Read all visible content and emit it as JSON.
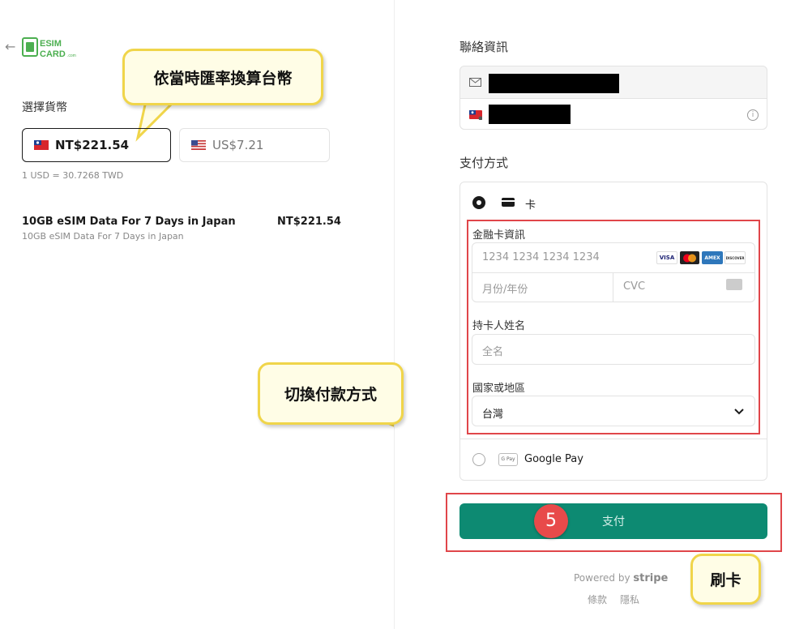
{
  "left": {
    "logo_line1": "ESIM",
    "logo_line2": "CARD",
    "logo_line3": ".com",
    "section_label": "選擇貨幣",
    "currency_selected": "NT$221.54",
    "currency_other": "US$7.21",
    "rate_note": "1 USD = 30.7268 TWD",
    "item_name": "10GB eSIM Data For 7 Days in Japan",
    "item_desc": "10GB eSIM Data For 7 Days in Japan",
    "item_price": "NT$221.54"
  },
  "right": {
    "contact_heading": "聯絡資訊",
    "pay_heading": "支付方式",
    "card_label": "卡",
    "card_info_label": "金融卡資訊",
    "card_number_placeholder": "1234 1234 1234 1234",
    "expiry_placeholder": "月份/年份",
    "cvc_placeholder": "CVC",
    "brands": {
      "visa": "VISA",
      "amex": "AMEX",
      "discover": "DISCOVER"
    },
    "holder_label": "持卡人姓名",
    "holder_placeholder": "全名",
    "country_label": "國家或地區",
    "country_value": "台灣",
    "gpay_icon": "G Pay",
    "gpay_label": "Google Pay",
    "pay_button": "支付",
    "powered_prefix": "Powered by",
    "powered_brand": "stripe",
    "terms_link": "條款",
    "privacy_link": "隱私"
  },
  "annotations": {
    "bubble_rate": "依當時匯率換算台幣",
    "bubble_switch": "切換付款方式",
    "bubble_pay": "刷卡",
    "step_number": "5"
  },
  "colors": {
    "accent": "#0d8a72",
    "highlight": "#e0464a",
    "bubble": "#fffde6"
  }
}
